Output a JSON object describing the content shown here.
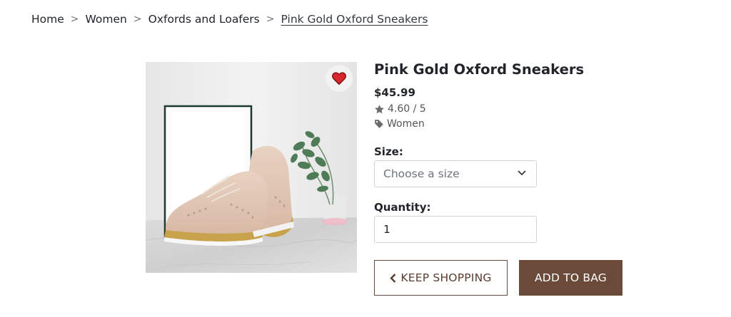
{
  "breadcrumb": {
    "items": [
      "Home",
      "Women",
      "Oxfords and Loafers"
    ],
    "current": "Pink Gold Oxford Sneakers",
    "separator": ">"
  },
  "product": {
    "title": "Pink Gold Oxford Sneakers",
    "price": "$45.99",
    "rating": "4.60 / 5",
    "category": "Women",
    "favorite_icon": "heart-icon",
    "favorited": true
  },
  "size": {
    "label": "Size:",
    "placeholder": "Choose a size"
  },
  "quantity": {
    "label": "Quantity:",
    "value": "1"
  },
  "buttons": {
    "keep_shopping": "KEEP SHOPPING",
    "add_to_bag": "ADD TO BAG"
  },
  "colors": {
    "accent": "#6b4a3a",
    "heart": "#d9262c"
  }
}
